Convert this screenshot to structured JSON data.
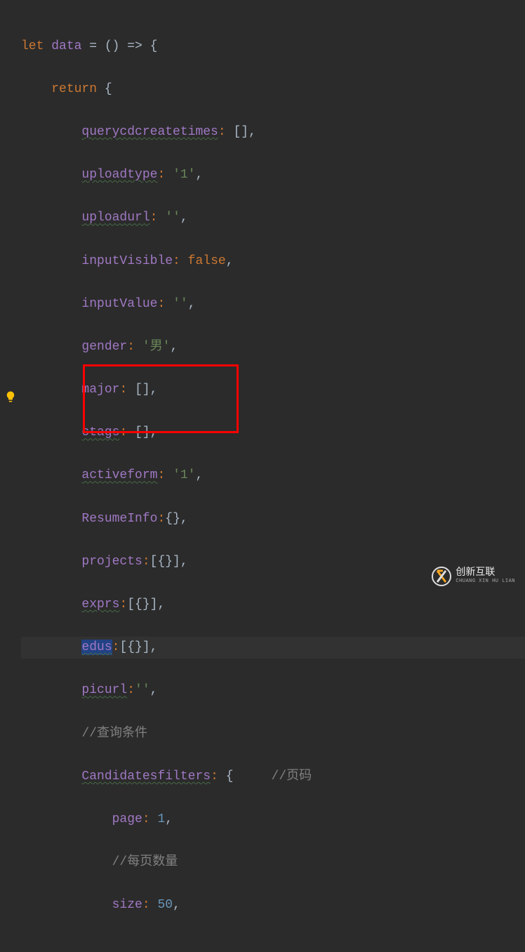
{
  "code": {
    "line1": {
      "kw": "let",
      "ident": "data",
      "op": "= () => {"
    },
    "line2": {
      "kw": "return",
      "brace": "{"
    },
    "props": {
      "querycdcreatetimes": {
        "name": "querycdcreatetimes",
        "value": "[],"
      },
      "uploadtype": {
        "name": "uploadtype",
        "value": "'1',",
        "str": "'1'"
      },
      "uploadurl": {
        "name": "uploadurl",
        "value": "'',",
        "str": "''"
      },
      "inputVisible": {
        "name": "inputVisible",
        "value": "false,",
        "bool": "false"
      },
      "inputValue": {
        "name": "inputValue",
        "value": "'',",
        "str": "''"
      },
      "gender": {
        "name": "gender",
        "value": "'男',",
        "str": "'男'"
      },
      "major": {
        "name": "major",
        "value": "[],"
      },
      "ctags": {
        "name": "ctags",
        "value": "[],"
      },
      "activeform": {
        "name": "activeform",
        "value": "'1',",
        "str": "'1'"
      },
      "ResumeInfo": {
        "name": "ResumeInfo",
        "value": "{},"
      },
      "projects": {
        "name": "projects",
        "value": "[{}],"
      },
      "exprs": {
        "name": "exprs",
        "value": "[{}],"
      },
      "edus": {
        "name": "edus",
        "value": "[{}],"
      },
      "picurl": {
        "name": "picurl",
        "value": "'',",
        "str": "''"
      },
      "comment_query": "//查询条件",
      "Candidatesfilters": {
        "name": "Candidatesfilters",
        "value": "{",
        "comment": "//页码"
      },
      "page": {
        "name": "page",
        "value": "1,",
        "num": "1"
      },
      "comment_perpage": "//每页数量",
      "size": {
        "name": "size",
        "value": "50,",
        "num": "50"
      }
    }
  },
  "watermark": {
    "text": "创新互联",
    "sub": "CHUANG XIN HU LIAN"
  }
}
